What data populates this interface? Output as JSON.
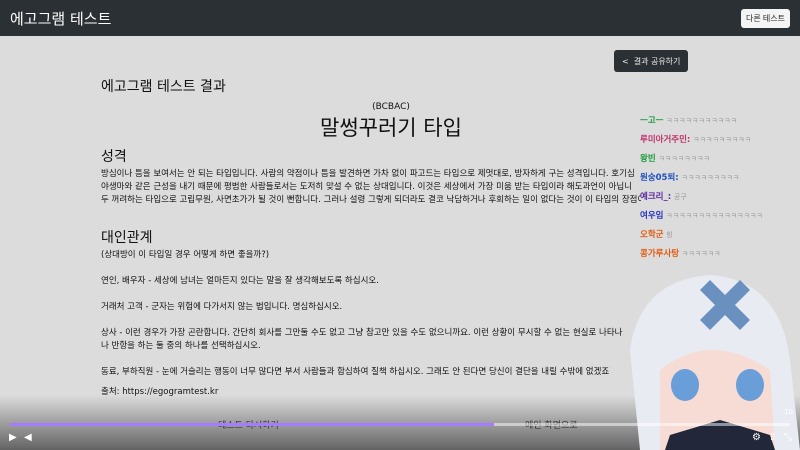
{
  "nav": {
    "brand": "에고그램 테스트",
    "other_test": "다른 테스트"
  },
  "share": {
    "label": "결과 공유하기",
    "icon": "share-icon"
  },
  "result": {
    "heading": "에고그램 테스트 결과",
    "code": "(BCBAC)",
    "type_name": "말썽꾸러기 타입"
  },
  "personality": {
    "heading": "성격",
    "lines": [
      "방심이나 틈을 보여서는 안 되는 타입입니다. 사람의 약점이나 틈을 발견하면 가차 없이 파고드는 타입으로 제멋대로, 방자하게 구는 성격입니다. 호기심",
      "야생마와 같은 근성을 내기 때문에 평범한 사람들로서는 도저히 맞설 수 없는 상대입니다. 이것은 세상에서 가장 미움 받는 타입이라 해도과언이 아닙니",
      "두 꺼려하는 타입으로 고립무원, 사면초가가 될 것이 뻔합니다. 그러나 설령 그렇게 되더라도 결코 낙담하거나 후회하는 일이 없다는 것이 이 타입의 장점이겠죠?"
    ]
  },
  "relations": {
    "heading": "대인관계",
    "intro": "(상대방이 이 타입일 경우 어떻게 하면 좋을까?)",
    "items": [
      "연인, 배우자 - 세상에 남녀는 얼마든지 있다는 말을 잘 생각해보도록 하십시오.",
      "거래처 고객 - 군자는 위험에 다가서지 않는 법입니다. 명심하십시오.",
      "상사 - 이런 경우가 가장 곤란합니다. 간단히 회사를 그만둘 수도 없고 그냥 참고만 있을 수도 없으니까요. 이런 상황이 무시할 수 없는 현실로 나타나",
      "나 반항을 하는 둘 중의 하나를 선택하십시오.",
      "동료, 부하직원 - 눈에 거슬리는 행동이 너무 많다면 부서 사람들과 합심하여 질책 하십시오. 그래도 안 된다면 당신이 결단을 내릴 수밖에 없겠죠"
    ],
    "source": "출처: https://egogramtest.kr"
  },
  "footer": {
    "retry": "테스트 다시하기",
    "home": "메인 화면으로"
  },
  "player": {
    "progress": 0.62,
    "timer": "10",
    "accent": "#a57bff"
  },
  "chat": [
    {
      "name": "ㅡ고ㅡ",
      "color": "#1a9a3a",
      "msg": "ㅋㅋㅋㅋㅋㅋㅋㅋㅋㅋㅋ"
    },
    {
      "name": "루미아거주민:",
      "color": "#c0306a",
      "msg": "ㅋㅋㅋㅋㅋㅋㅋㅋㅋ"
    },
    {
      "name": "왕빈",
      "color": "#1a9a3a",
      "msg": "ㅋㅋㅋㅋㅋㅋㅋㅋ"
    },
    {
      "name": "원숭05퇴:",
      "color": "#2050c0",
      "msg": "ㅋㅋㅋㅋㅋㅋㅋㅋㅋ"
    },
    {
      "name": "예크리_:",
      "color": "#5a2aa0",
      "msg": "공구"
    },
    {
      "name": "여우임",
      "color": "#2030c0",
      "msg": "ㅋㅋㅋㅋㅋㅋㅋㅋㅋㅋㅋㅋㅋㅋㅋ"
    },
    {
      "name": "오학군",
      "color": "#e05a10",
      "msg": "힝"
    },
    {
      "name": "콩가루사탕",
      "color": "#e05a10",
      "msg": "ㅋㅋㅋㅋㅋㅋ"
    }
  ]
}
